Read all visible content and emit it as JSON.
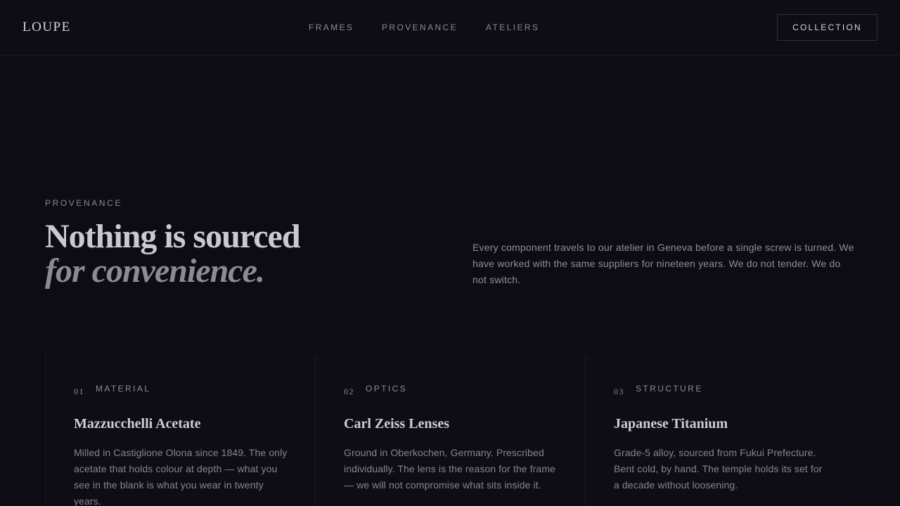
{
  "header": {
    "logo": "LOUPE",
    "nav": [
      {
        "label": "FRAMES"
      },
      {
        "label": "PROVENANCE"
      },
      {
        "label": "ATELIERS"
      }
    ],
    "cta_label": "COLLECTION"
  },
  "hero": {
    "eyebrow": "PROVENANCE",
    "headline_line1": "Nothing is sourced",
    "headline_line2": "for convenience.",
    "lede": "Every component travels to our atelier in Geneva before a single screw is turned. We have worked with the same suppliers for nineteen years. We do not tender. We do not switch."
  },
  "cards": [
    {
      "number": "01",
      "kicker": "MATERIAL",
      "title": "Mazzucchelli Acetate",
      "body": "Milled in Castiglione Olona since 1849. The only acetate that holds colour at depth — what you see in the blank is what you wear in twenty years."
    },
    {
      "number": "02",
      "kicker": "OPTICS",
      "title": "Carl Zeiss Lenses",
      "body": "Ground in Oberkochen, Germany. Prescribed individually. The lens is the reason for the frame — we will not compromise what sits inside it."
    },
    {
      "number": "03",
      "kicker": "STRUCTURE",
      "title": "Japanese Titanium",
      "body": "Grade-5 alloy, sourced from Fukui Prefecture. Bent cold, by hand. The temple holds its set for a decade without loosening."
    }
  ]
}
